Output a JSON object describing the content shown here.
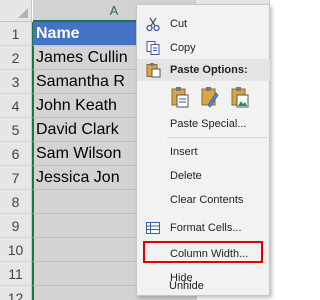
{
  "sheet": {
    "column_headers": [
      "A"
    ],
    "row_numbers": [
      "1",
      "2",
      "3",
      "4",
      "5",
      "6",
      "7",
      "8",
      "9",
      "10",
      "11",
      "12"
    ],
    "cells": [
      "Name",
      "James Cullin",
      "Samantha R",
      "John Keath",
      "David Clark",
      "Sam Wilson",
      "Jessica Jon"
    ]
  },
  "context_menu": {
    "cut": "Cut",
    "copy": "Copy",
    "paste_options": "Paste Options:",
    "paste_special": "Paste Special...",
    "insert": "Insert",
    "delete": "Delete",
    "clear_contents": "Clear Contents",
    "format_cells": "Format Cells...",
    "column_width": "Column Width...",
    "hide": "Hide",
    "unhide": "Unhide"
  },
  "colors": {
    "header_fill": "#4472c4",
    "selected_column": "#d3d3d3",
    "excel_green": "#217346",
    "highlight_box": "#e00000"
  }
}
